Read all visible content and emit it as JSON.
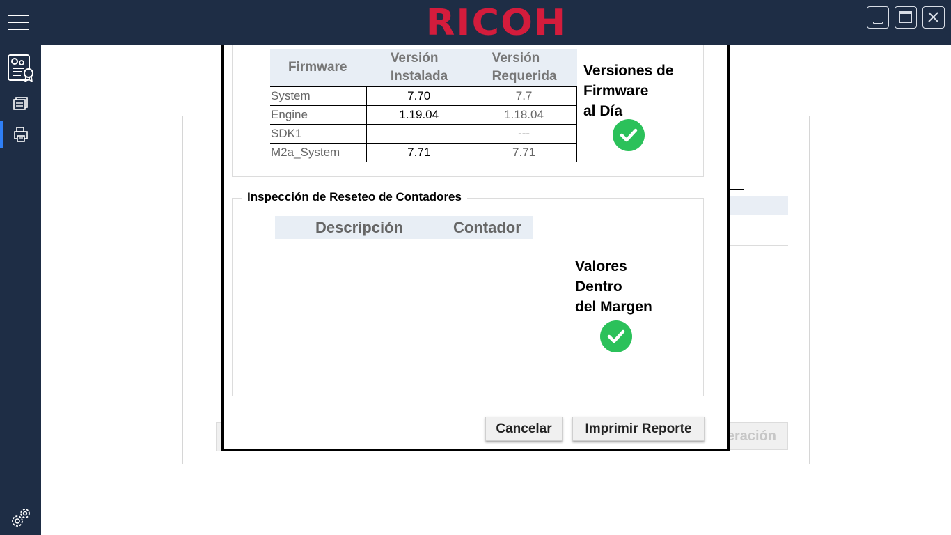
{
  "app": {
    "logo_text": "RICOH",
    "brand_color": "#d41c3c",
    "chrome_color": "#1e2d45",
    "accent_color": "#2f7ff6"
  },
  "window_controls": {
    "minimize_icon": "minimize-icon",
    "maximize_icon": "maximize-icon",
    "close_icon": "close-icon"
  },
  "sidebar": {
    "items": [
      {
        "icon": "config-certificate-icon",
        "active": false
      },
      {
        "icon": "document-stack-icon",
        "active": false
      },
      {
        "icon": "printer-report-icon",
        "active": true
      }
    ],
    "footer_icon": "settings-gears-icon"
  },
  "background": {
    "partial_button_label": "eración"
  },
  "firmware": {
    "headers": {
      "component": "Firmware",
      "installed": "Versión Instalada",
      "required": "Versión Requerida"
    },
    "rows": [
      {
        "component": "System",
        "installed": "7.70",
        "required": "7.7"
      },
      {
        "component": "Engine",
        "installed": "1.19.04",
        "required": "1.18.04"
      },
      {
        "component": "SDK1",
        "installed": "",
        "required": "---"
      },
      {
        "component": "M2a_System",
        "installed": "7.71",
        "required": "7.71"
      }
    ],
    "status": {
      "line1": "Versiones de",
      "line2": "Firmware",
      "line3": "al Día",
      "ok_color": "#2bc15a"
    }
  },
  "counters": {
    "section_title": "Inspección de Reseteo de Contadores",
    "headers": {
      "description": "Descripción",
      "counter": "Contador"
    },
    "rows": [],
    "status": {
      "line1": "Valores",
      "line2": "Dentro",
      "line3": "del Margen"
    }
  },
  "actions": {
    "cancel_label": "Cancelar",
    "print_label": "Imprimir Reporte"
  }
}
